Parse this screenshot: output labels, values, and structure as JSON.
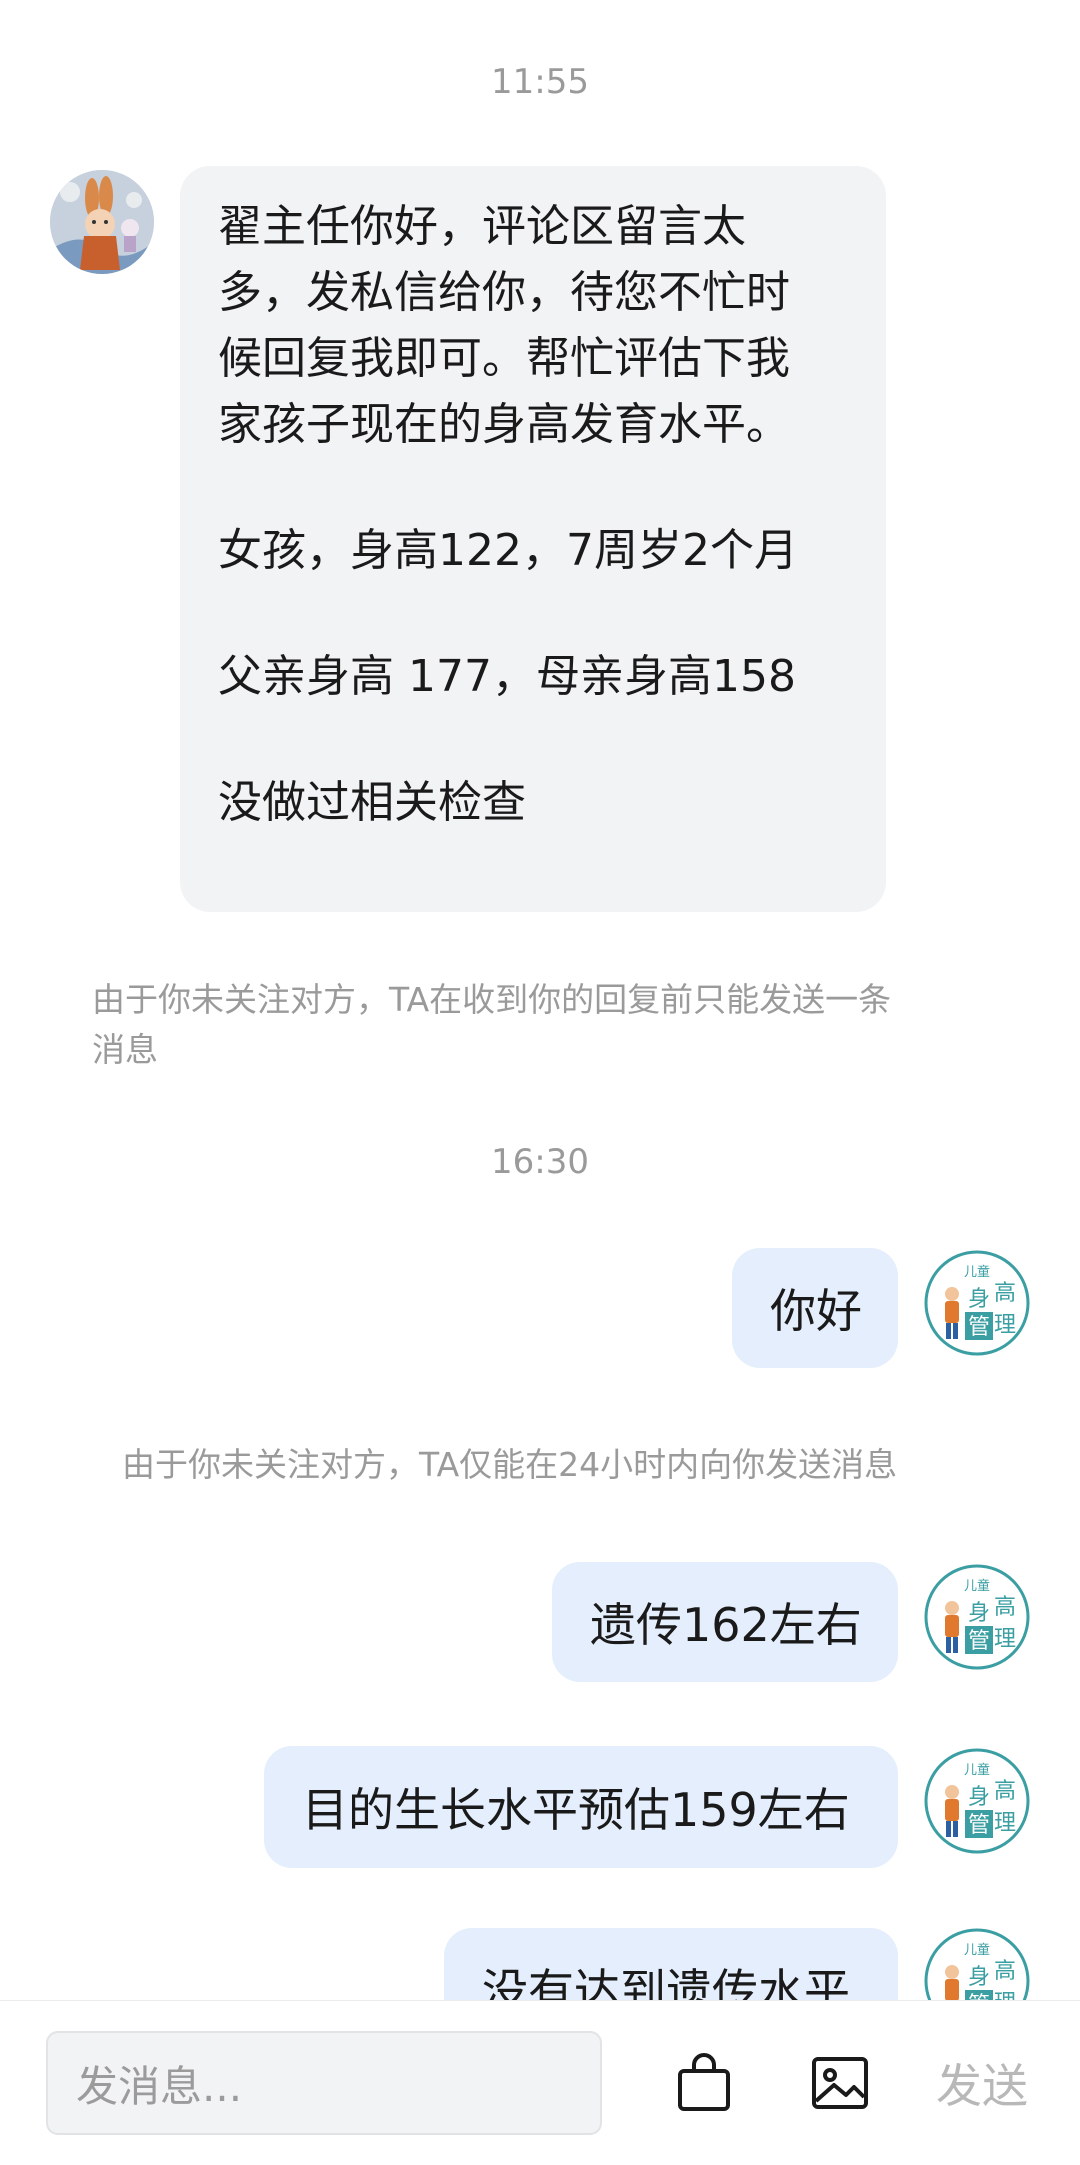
{
  "chat": {
    "time_1": "11:55",
    "incoming_message": {
      "lines": [
        "翟主任你好，评论区留言太",
        "多，发私信给你，待您不忙时",
        "候回复我即可。帮忙评估下我",
        "家孩子现在的身高发育水平。",
        "女孩，身高122，7周岁2个月",
        "父亲身高  177，母亲身高158",
        "没做过相关检查"
      ]
    },
    "notice_1_line1": "由于你未关注对方，TA在收到你的回复前只能发送一条",
    "notice_1_line2": "消息",
    "time_2": "16:30",
    "reply_1": "你好",
    "notice_2": "由于你未关注对方，TA仅能在24小时内向你发送消息",
    "reply_2": "遗传162左右",
    "reply_3": "目的生长水平预估159左右",
    "reply_4": "没有达到遗传水平",
    "avatar_logo": {
      "top": "儿童",
      "chars": [
        "身",
        "高",
        "管",
        "理"
      ]
    }
  },
  "composer": {
    "placeholder": "发消息...",
    "send_label": "发送",
    "icons": [
      "shopping-bag-icon",
      "image-icon"
    ]
  },
  "colors": {
    "incoming_bubble": "#f2f3f5",
    "outgoing_bubble": "#e4eefc",
    "system_text": "#9a9a9a",
    "logo_teal": "#3a9ea2"
  }
}
